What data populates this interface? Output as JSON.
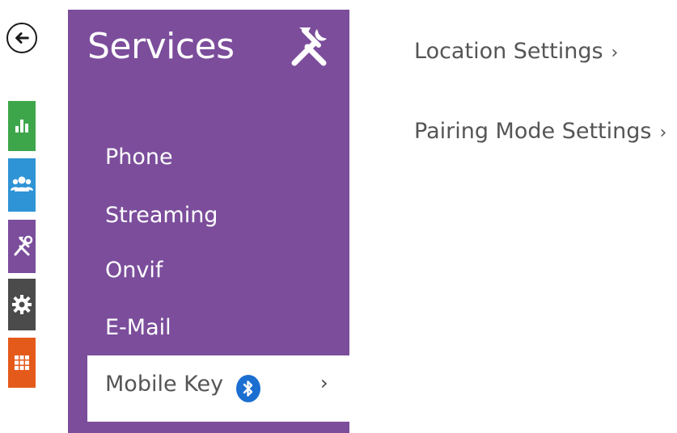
{
  "colors": {
    "purple": "#7b4d9b",
    "status_green": "#3ea64a",
    "directory_blue": "#2f94d6",
    "services_purple": "#7b4d9b",
    "hardware_gray": "#4b4b4b",
    "system_orange": "#e45a1b",
    "bluetooth_blue": "#1b6fd1"
  },
  "icons": {
    "back": "arrow-left-icon",
    "status": "bar-chart-icon",
    "directory": "users-icon",
    "services": "tools-icon",
    "hardware": "gear-icon",
    "system": "grid-icon",
    "bluetooth": "bluetooth-icon"
  },
  "services_panel": {
    "title": "Services",
    "menu": [
      {
        "label": "Phone"
      },
      {
        "label": "Streaming"
      },
      {
        "label": "Onvif"
      },
      {
        "label": "E-Mail"
      }
    ],
    "active_item": {
      "label": "Mobile Key",
      "chevron": "›"
    }
  },
  "content": {
    "links": [
      {
        "label": "Location Settings",
        "chevron": "›"
      },
      {
        "label": "Pairing Mode Settings",
        "chevron": "›"
      }
    ]
  }
}
